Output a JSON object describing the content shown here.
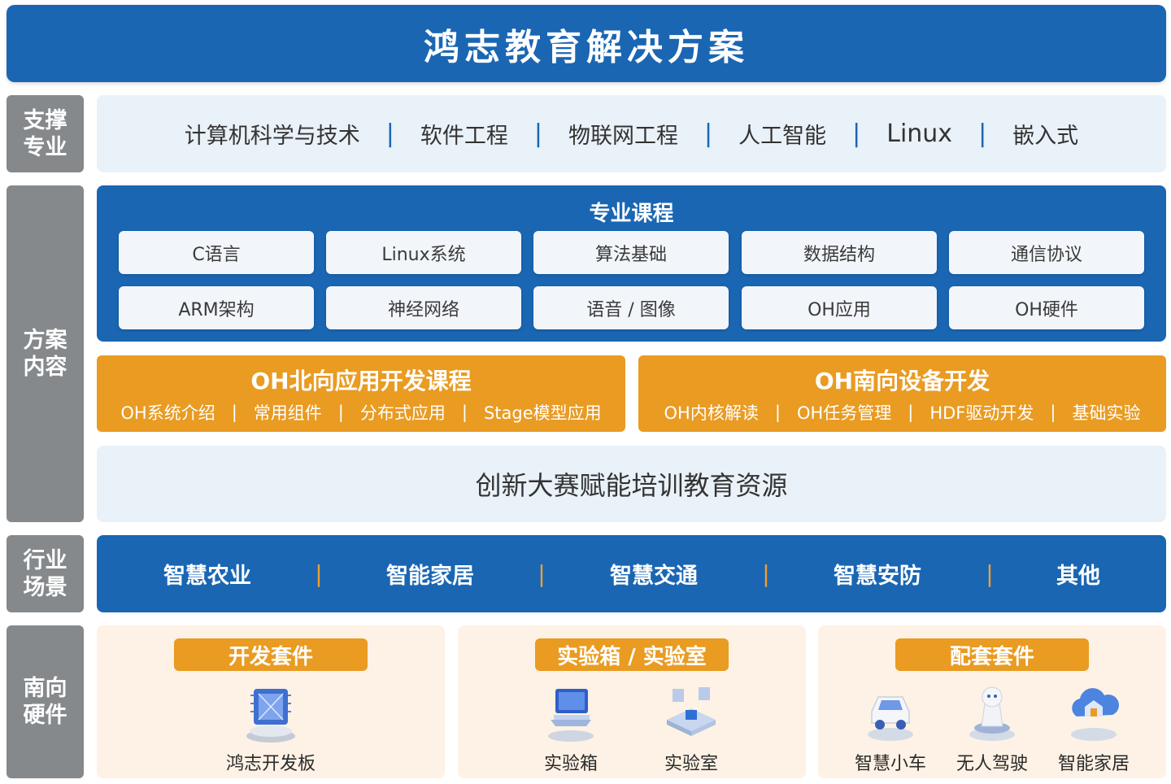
{
  "header": {
    "title": "鸿志教育解决方案"
  },
  "side_labels": {
    "support": "支撑专业",
    "content": "方案内容",
    "industry": "行业场景",
    "hardware": "南向硬件"
  },
  "majors": [
    "计算机科学与技术",
    "软件工程",
    "物联网工程",
    "人工智能",
    "Linux",
    "嵌入式"
  ],
  "separator": "|",
  "courses": {
    "title": "专业课程",
    "items": [
      "C语言",
      "Linux系统",
      "算法基础",
      "数据结构",
      "通信协议",
      "ARM架构",
      "神经网络",
      "语音 / 图像",
      "OH应用",
      "OH硬件"
    ]
  },
  "oh_north": {
    "title": "OH北向应用开发课程",
    "items": [
      "OH系统介绍",
      "常用组件",
      "分布式应用",
      "Stage模型应用"
    ]
  },
  "oh_south": {
    "title": "OH南向设备开发",
    "items": [
      "OH内核解读",
      "OH任务管理",
      "HDF驱动开发",
      "基础实验"
    ]
  },
  "innovation": {
    "title": "创新大赛赋能培训教育资源"
  },
  "industry": {
    "items": [
      "智慧农业",
      "智能家居",
      "智慧交通",
      "智慧安防",
      "其他"
    ]
  },
  "hardware": {
    "dev_kit": {
      "title": "开发套件",
      "items": [
        {
          "label": "鸿志开发板",
          "icon": "chip-icon"
        }
      ]
    },
    "lab": {
      "title": "实验箱 / 实验室",
      "items": [
        {
          "label": "实验箱",
          "icon": "laptop-icon"
        },
        {
          "label": "实验室",
          "icon": "lab-platform-icon"
        }
      ]
    },
    "support_kit": {
      "title": "配套套件",
      "items": [
        {
          "label": "智慧小车",
          "icon": "car-icon"
        },
        {
          "label": "无人驾驶",
          "icon": "robot-icon"
        },
        {
          "label": "智能家居",
          "icon": "smart-home-icon"
        }
      ]
    }
  },
  "colors": {
    "primary_blue": "#1a66b3",
    "accent_orange": "#e99b22",
    "side_gray": "#85898c",
    "light_blue": "#e9f1f9",
    "light_orange": "#fdf2e5"
  }
}
